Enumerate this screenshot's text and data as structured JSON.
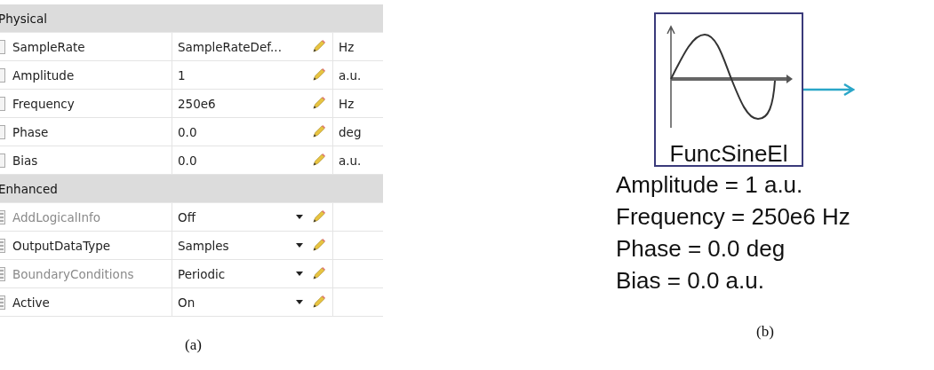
{
  "property_grid": {
    "sections": [
      {
        "title": "Physical",
        "rows": [
          {
            "kind": "value",
            "name": "SampleRate",
            "value": "SampleRateDef...",
            "unit": "Hz",
            "disabled": false
          },
          {
            "kind": "value",
            "name": "Amplitude",
            "value": "1",
            "unit": "a.u.",
            "disabled": false
          },
          {
            "kind": "value",
            "name": "Frequency",
            "value": "250e6",
            "unit": "Hz",
            "disabled": false
          },
          {
            "kind": "value",
            "name": "Phase",
            "value": "0.0",
            "unit": "deg",
            "disabled": false
          },
          {
            "kind": "value",
            "name": "Bias",
            "value": "0.0",
            "unit": "a.u.",
            "disabled": false
          }
        ]
      },
      {
        "title": "Enhanced",
        "rows": [
          {
            "kind": "choice",
            "name": "AddLogicalInfo",
            "value": "Off",
            "disabled": true
          },
          {
            "kind": "choice",
            "name": "OutputDataType",
            "value": "Samples",
            "disabled": false
          },
          {
            "kind": "choice",
            "name": "BoundaryConditions",
            "value": "Periodic",
            "disabled": true
          },
          {
            "kind": "choice",
            "name": "Active",
            "value": "On",
            "disabled": false
          }
        ]
      }
    ]
  },
  "caption_a": "(a)",
  "block": {
    "label": "FuncSineEl",
    "parameters": [
      "Amplitude = 1 a.u.",
      "Frequency = 250e6 Hz",
      "Phase = 0.0 deg",
      "Bias = 0.0 a.u."
    ]
  },
  "caption_b": "(b)"
}
